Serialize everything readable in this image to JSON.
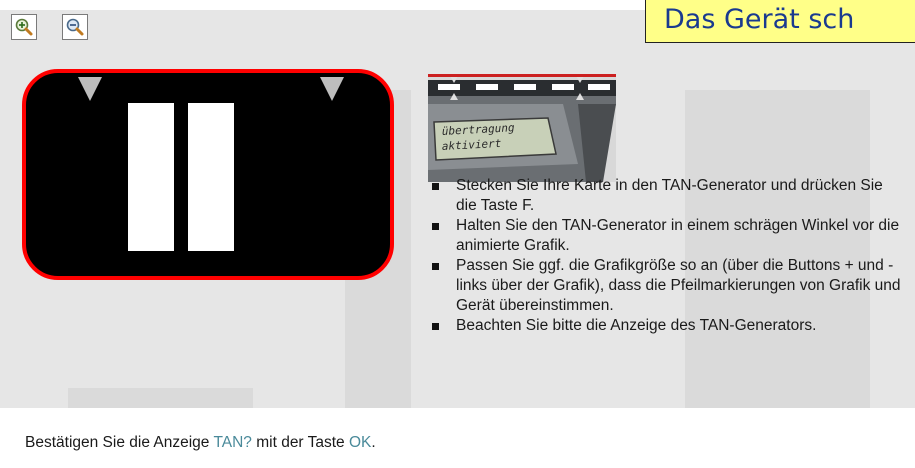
{
  "zoom": {
    "in_icon": "zoom-in-icon",
    "out_icon": "zoom-out-icon"
  },
  "notice": {
    "text": "Das Gerät sch"
  },
  "device": {
    "screen_line1": "übertragung",
    "screen_line2": "aktiviert"
  },
  "instructions": [
    "Stecken Sie Ihre Karte in den TAN-Generator und drücken Sie die Taste F.",
    "Halten Sie den TAN-Generator in einem schrägen Winkel vor die animierte Grafik.",
    "Passen Sie ggf. die Grafikgröße so an (über die Buttons + und - links über der Grafik), dass die Pfeilmarkierungen von Grafik und Gerät übereinstimmen.",
    "Beachten Sie bitte die Anzeige des TAN-Generators."
  ],
  "footer": {
    "part1": "Bestätigen Sie die Anzeige ",
    "kw1": "TAN?",
    "part2": " mit der Taste ",
    "kw2": "OK",
    "part3": "."
  },
  "colors": {
    "panel": "#e6e6e6",
    "flicker_border": "#ff0000",
    "notice_bg": "#ffff88",
    "notice_text": "#1a3a8f",
    "keyword": "#4a8a9a"
  }
}
